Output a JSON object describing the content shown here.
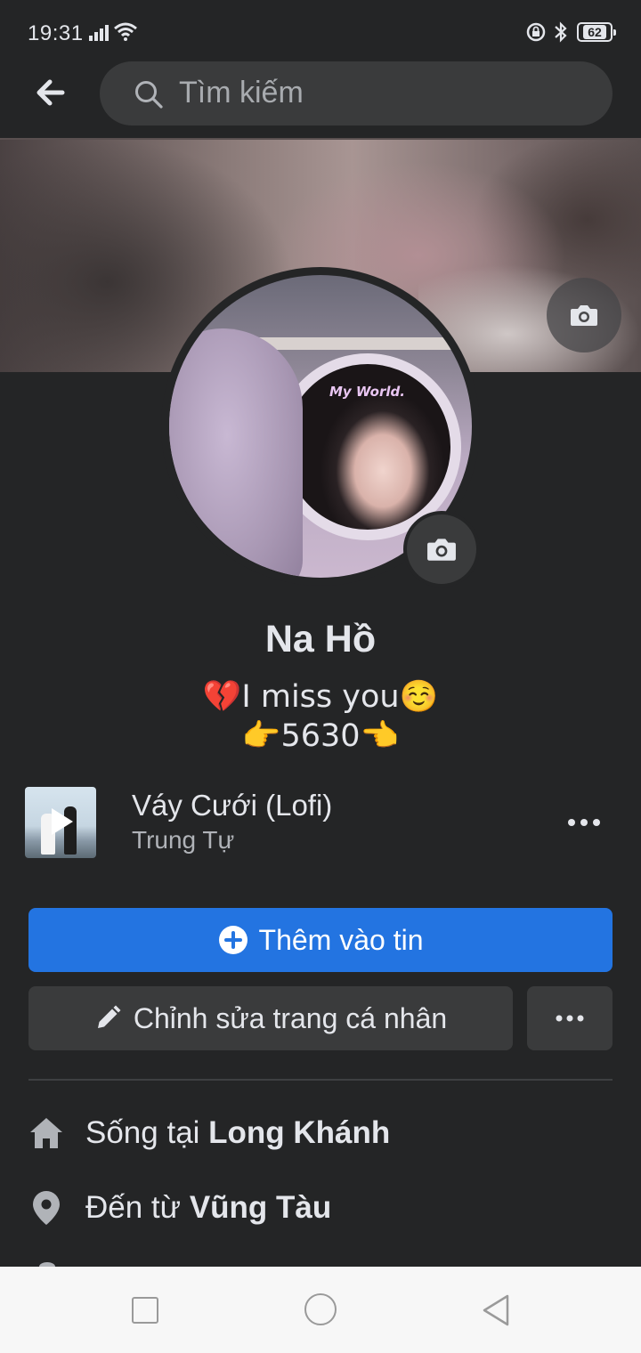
{
  "status_bar": {
    "time": "19:31",
    "battery": "62"
  },
  "search": {
    "placeholder": "Tìm kiếm"
  },
  "profile": {
    "name": "Na Hồ",
    "bio_line_1": "💔I miss you☺️",
    "bio_line_2": "👉5630👈",
    "avatar_overlay_text": "My World."
  },
  "music": {
    "title": "Váy Cưới (Lofi)",
    "artist": "Trung Tự"
  },
  "actions": {
    "add_story_label": "Thêm vào tin",
    "edit_profile_label": "Chỉnh sửa trang cá nhân"
  },
  "info": {
    "lives_prefix": "Sống tại ",
    "lives_place": "Long Khánh",
    "from_prefix": "Đến từ ",
    "from_place": "Vũng Tàu"
  },
  "colors": {
    "accent": "#2374e1",
    "background": "#242526",
    "surface": "#3a3b3c"
  },
  "icons": [
    "back-arrow-icon",
    "search-icon",
    "camera-icon",
    "play-icon",
    "more-icon",
    "plus-circle-icon",
    "pencil-icon",
    "home-icon",
    "location-pin-icon"
  ]
}
